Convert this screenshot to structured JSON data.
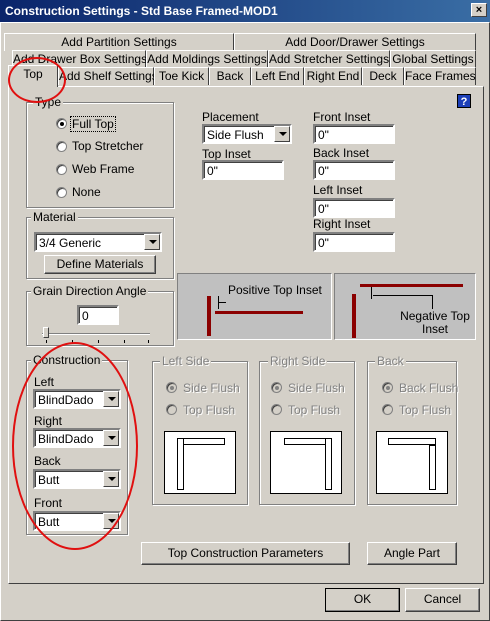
{
  "window": {
    "title": "Construction Settings - Std Base Framed-MOD1",
    "close_label": "×"
  },
  "tabs": {
    "row1": [
      "Add Partition Settings",
      "Add Door/Drawer Settings"
    ],
    "row2": [
      "Add Drawer Box Settings",
      "Add Moldings Settings",
      "Add Stretcher Settings",
      "Global Settings"
    ],
    "row3": [
      "Top",
      "Add Shelf Settings",
      "Toe Kick",
      "Back",
      "Left End",
      "Right End",
      "Deck",
      "Face Frames"
    ],
    "active": "Top"
  },
  "help": {
    "label": "?"
  },
  "type_group": {
    "label": "Type",
    "options": [
      "Full Top",
      "Top Stretcher",
      "Web Frame",
      "None"
    ],
    "selected": "Full Top"
  },
  "placement": {
    "label": "Placement",
    "value": "Side Flush",
    "top_inset_label": "Top Inset",
    "top_inset_value": "0\""
  },
  "insets": {
    "front_label": "Front Inset",
    "front_value": "0\"",
    "back_label": "Back Inset",
    "back_value": "0\"",
    "left_label": "Left Inset",
    "left_value": "0\"",
    "right_label": "Right Inset",
    "right_value": "0\""
  },
  "material_group": {
    "label": "Material",
    "value": "3/4 Generic",
    "define_button": "Define Materials"
  },
  "grain_group": {
    "label": "Grain Direction Angle",
    "value": "0"
  },
  "diagrams": {
    "positive_label": "Positive Top Inset",
    "negative_label": "Negative Top Inset"
  },
  "construction_group": {
    "label": "Construction",
    "left_label": "Left",
    "left_value": "BlindDado",
    "right_label": "Right",
    "right_value": "BlindDado",
    "back_label": "Back",
    "back_value": "Butt",
    "front_label": "Front",
    "front_value": "Butt"
  },
  "side_groups": {
    "left": {
      "label": "Left Side",
      "option1": "Side Flush",
      "option2": "Top Flush"
    },
    "right": {
      "label": "Right Side",
      "option1": "Side Flush",
      "option2": "Top Flush"
    },
    "back": {
      "label": "Back",
      "option1": "Back Flush",
      "option2": "Top Flush"
    }
  },
  "buttons": {
    "top_params": "Top Construction Parameters",
    "angle_part": "Angle Part",
    "ok": "OK",
    "cancel": "Cancel"
  },
  "colors": {
    "annotation_red": "#e01010",
    "titlebar_start": "#0a246a",
    "diagram_line": "#8b0000"
  }
}
